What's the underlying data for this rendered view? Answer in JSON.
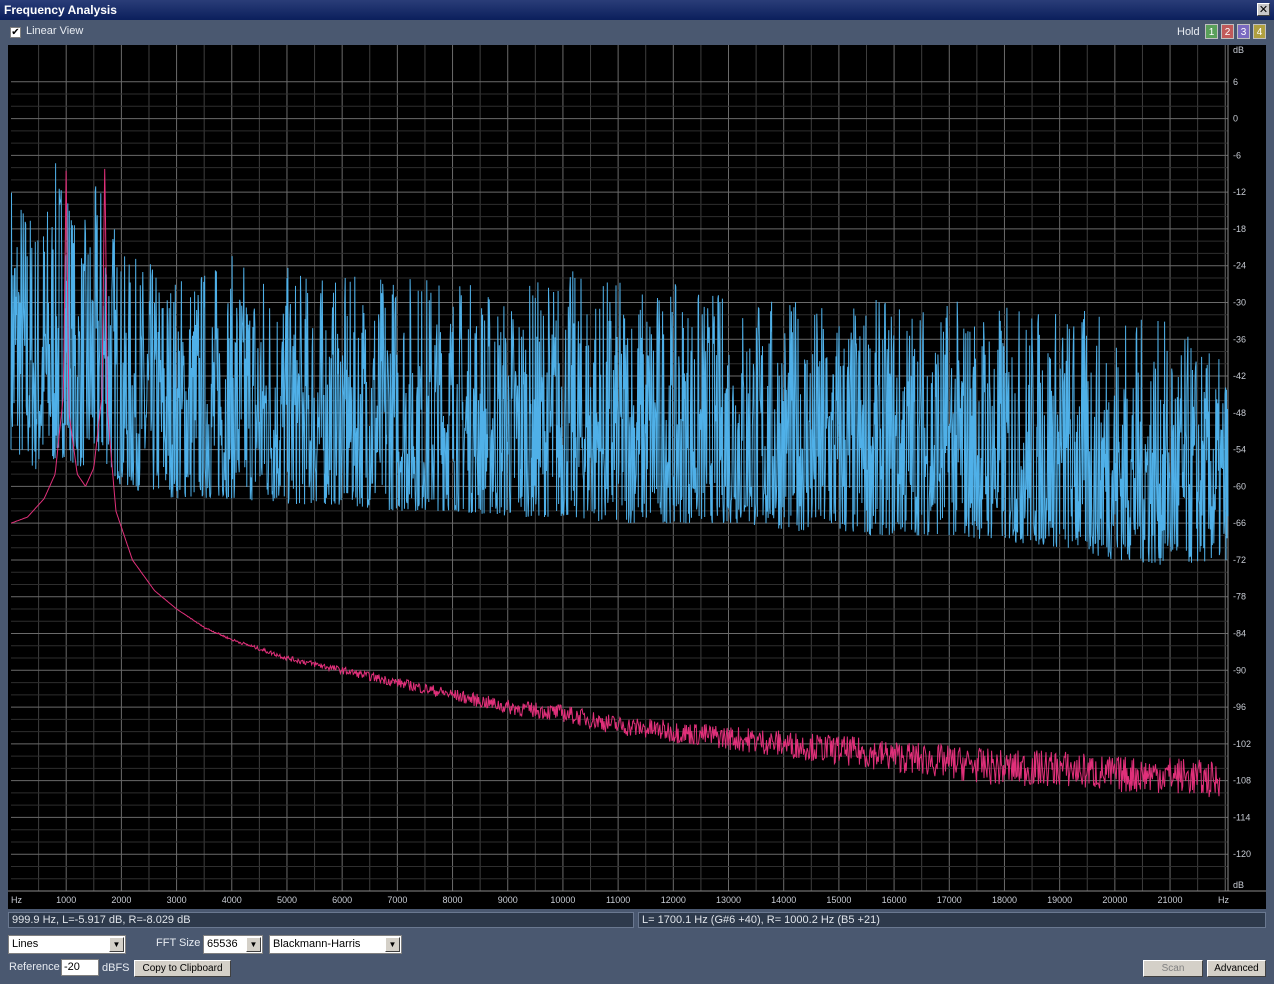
{
  "window": {
    "title": "Frequency Analysis",
    "close_glyph": "✕"
  },
  "toolbar": {
    "linear_view_label": "Linear View",
    "linear_view_checked": true,
    "hold_label": "Hold",
    "hold_buttons": [
      {
        "label": "1",
        "color": "#5aa05a"
      },
      {
        "label": "2",
        "color": "#c05a5a"
      },
      {
        "label": "3",
        "color": "#7a6ac0"
      },
      {
        "label": "4",
        "color": "#b0a040"
      }
    ]
  },
  "chart_data": {
    "type": "line",
    "x_unit_label": "Hz",
    "y_unit_label": "dB",
    "x_ticks": [
      "1000",
      "2000",
      "3000",
      "4000",
      "5000",
      "6000",
      "7000",
      "8000",
      "9000",
      "10000",
      "11000",
      "12000",
      "13000",
      "14000",
      "15000",
      "16000",
      "17000",
      "18000",
      "19000",
      "20000",
      "21000"
    ],
    "y_ticks": [
      "6",
      "0",
      "-6",
      "-12",
      "-18",
      "-24",
      "-30",
      "-36",
      "-42",
      "-48",
      "-54",
      "-60",
      "-66",
      "-72",
      "-78",
      "-84",
      "-90",
      "-96",
      "-102",
      "-108",
      "-114",
      "-120"
    ],
    "xlim": [
      0,
      22050
    ],
    "ylim": [
      -126,
      12
    ],
    "grid": true,
    "series": [
      {
        "color": "#4fb0e8",
        "x": [
          0,
          500,
          999.9,
          1200,
          1700.1,
          2000,
          3000,
          4000,
          5000,
          6000,
          7000,
          8000,
          9000,
          10000,
          11000,
          12000,
          13000,
          14000,
          15000,
          16000,
          17000,
          18000,
          19000,
          20000,
          21000,
          22050
        ],
        "peak_db": [
          -6,
          -15,
          -2,
          -20,
          -6,
          -22,
          -24,
          -22,
          -24,
          -26,
          -24,
          -25,
          -28,
          -24,
          -26,
          -27,
          -28,
          -29,
          -30,
          -29,
          -29,
          -30,
          -30,
          -32,
          -33,
          -40
        ],
        "floor_db": [
          -54,
          -58,
          -55,
          -57,
          -56,
          -60,
          -62,
          -62,
          -63,
          -63,
          -64,
          -64,
          -65,
          -65,
          -66,
          -66,
          -66,
          -67,
          -68,
          -68,
          -68,
          -69,
          -70,
          -72,
          -73,
          -72
        ]
      },
      {
        "color": "#e0307a",
        "x": [
          0,
          300,
          600,
          800,
          950,
          999.9,
          1050,
          1200,
          1350,
          1500,
          1650,
          1700.1,
          1750,
          1900,
          2200,
          2600,
          3000,
          3500,
          4000,
          5000,
          6000,
          7000,
          8000,
          9000,
          10000,
          11000,
          12000,
          13000,
          14000,
          15000,
          16000,
          17000,
          18000,
          19000,
          20000,
          21000,
          21900
        ],
        "y": [
          -66,
          -65,
          -62,
          -58,
          -45,
          -8,
          -48,
          -58,
          -60,
          -57,
          -45,
          -6,
          -48,
          -64,
          -72,
          -77,
          -80,
          -83,
          -85,
          -88,
          -90,
          -92,
          -94,
          -96,
          -97,
          -99,
          -100,
          -101,
          -102,
          -103,
          -104,
          -105,
          -106,
          -106,
          -107,
          -107,
          -108
        ]
      }
    ]
  },
  "status": {
    "left": "999.9 Hz, L=-5.917 dB, R=-8.029 dB",
    "right": "L= 1700.1 Hz (G#6 +40), R= 1000.2 Hz (B5 +21)"
  },
  "controls": {
    "display_mode": "Lines",
    "fft_size_label": "FFT Size",
    "fft_size": "65536",
    "window_type": "Blackmann-Harris",
    "reference_label": "Reference",
    "reference_value": "-20",
    "reference_unit": "dBFS",
    "copy_label": "Copy to Clipboard",
    "scan_label": "Scan",
    "advanced_label": "Advanced"
  }
}
